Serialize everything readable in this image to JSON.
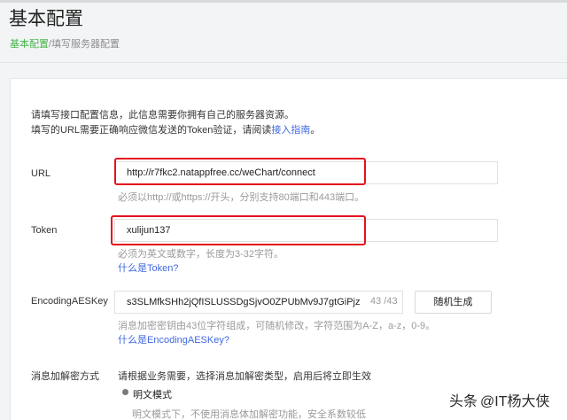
{
  "page": {
    "title": "基本配置"
  },
  "breadcrumb": {
    "current": "基本配置",
    "separator": "/",
    "child": "填写服务器配置"
  },
  "intro": {
    "line1": "请填写接口配置信息，此信息需要你拥有自己的服务器资源。",
    "line2_prefix": "填写的URL需要正确响应微信发送的Token验证，请阅读",
    "line2_link": "接入指南",
    "line2_suffix": "。"
  },
  "form": {
    "url": {
      "label": "URL",
      "value": "http://r7fkc2.natappfree.cc/weChart/connect",
      "hint": "必须以http://或https://开头，分别支持80端口和443端口。"
    },
    "token": {
      "label": "Token",
      "value": "xulijun137",
      "hint": "必须为英文或数字，长度为3-32字符。",
      "help_link": "什么是Token?"
    },
    "aes": {
      "label": "EncodingAESKey",
      "value": "s3SLMfkSHh2jQfISLUSSDgSjvO0ZPUbMv9J7gtGiPjz",
      "counter": "43 /43",
      "random_button": "随机生成",
      "hint": "消息加密密钥由43位字符组成，可随机修改，字符范围为A-Z，a-z，0-9。",
      "help_link": "什么是EncodingAESKey?"
    },
    "encryption": {
      "label": "消息加解密方式",
      "hint": "请根据业务需要，选择消息加解密类型，启用后将立即生效",
      "selected_option": "明文模式",
      "selected_desc": "明文模式下，不使用消息体加解密功能，安全系数较低"
    }
  },
  "watermark": {
    "platform": "头条",
    "author": "@IT杨大侠"
  }
}
